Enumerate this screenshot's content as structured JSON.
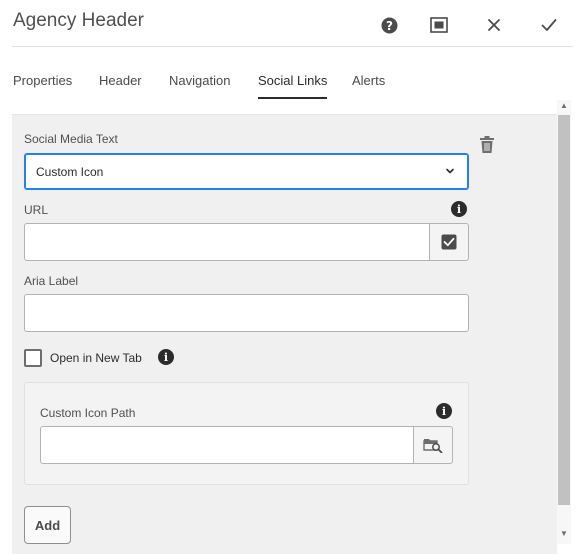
{
  "dialog": {
    "title": "Agency Header",
    "actions": {
      "help_icon": "help-icon",
      "fullscreen_icon": "fullscreen-icon",
      "close_icon": "close-icon",
      "done_icon": "check-icon"
    }
  },
  "tabs": [
    {
      "label": "Properties",
      "active": false
    },
    {
      "label": "Header",
      "active": false
    },
    {
      "label": "Navigation",
      "active": false
    },
    {
      "label": "Social Links",
      "active": true
    },
    {
      "label": "Alerts",
      "active": false
    }
  ],
  "form": {
    "social_media_text": {
      "label": "Social Media Text",
      "value": "Custom Icon"
    },
    "url": {
      "label": "URL",
      "value": ""
    },
    "aria_label": {
      "label": "Aria Label",
      "value": ""
    },
    "open_new_tab": {
      "label": "Open in New Tab",
      "checked": false
    },
    "custom_icon_path": {
      "label": "Custom Icon Path",
      "value": ""
    },
    "add_button": "Add"
  },
  "colors": {
    "focus_border": "#2680eb",
    "content_bg": "#f0f0f0"
  }
}
